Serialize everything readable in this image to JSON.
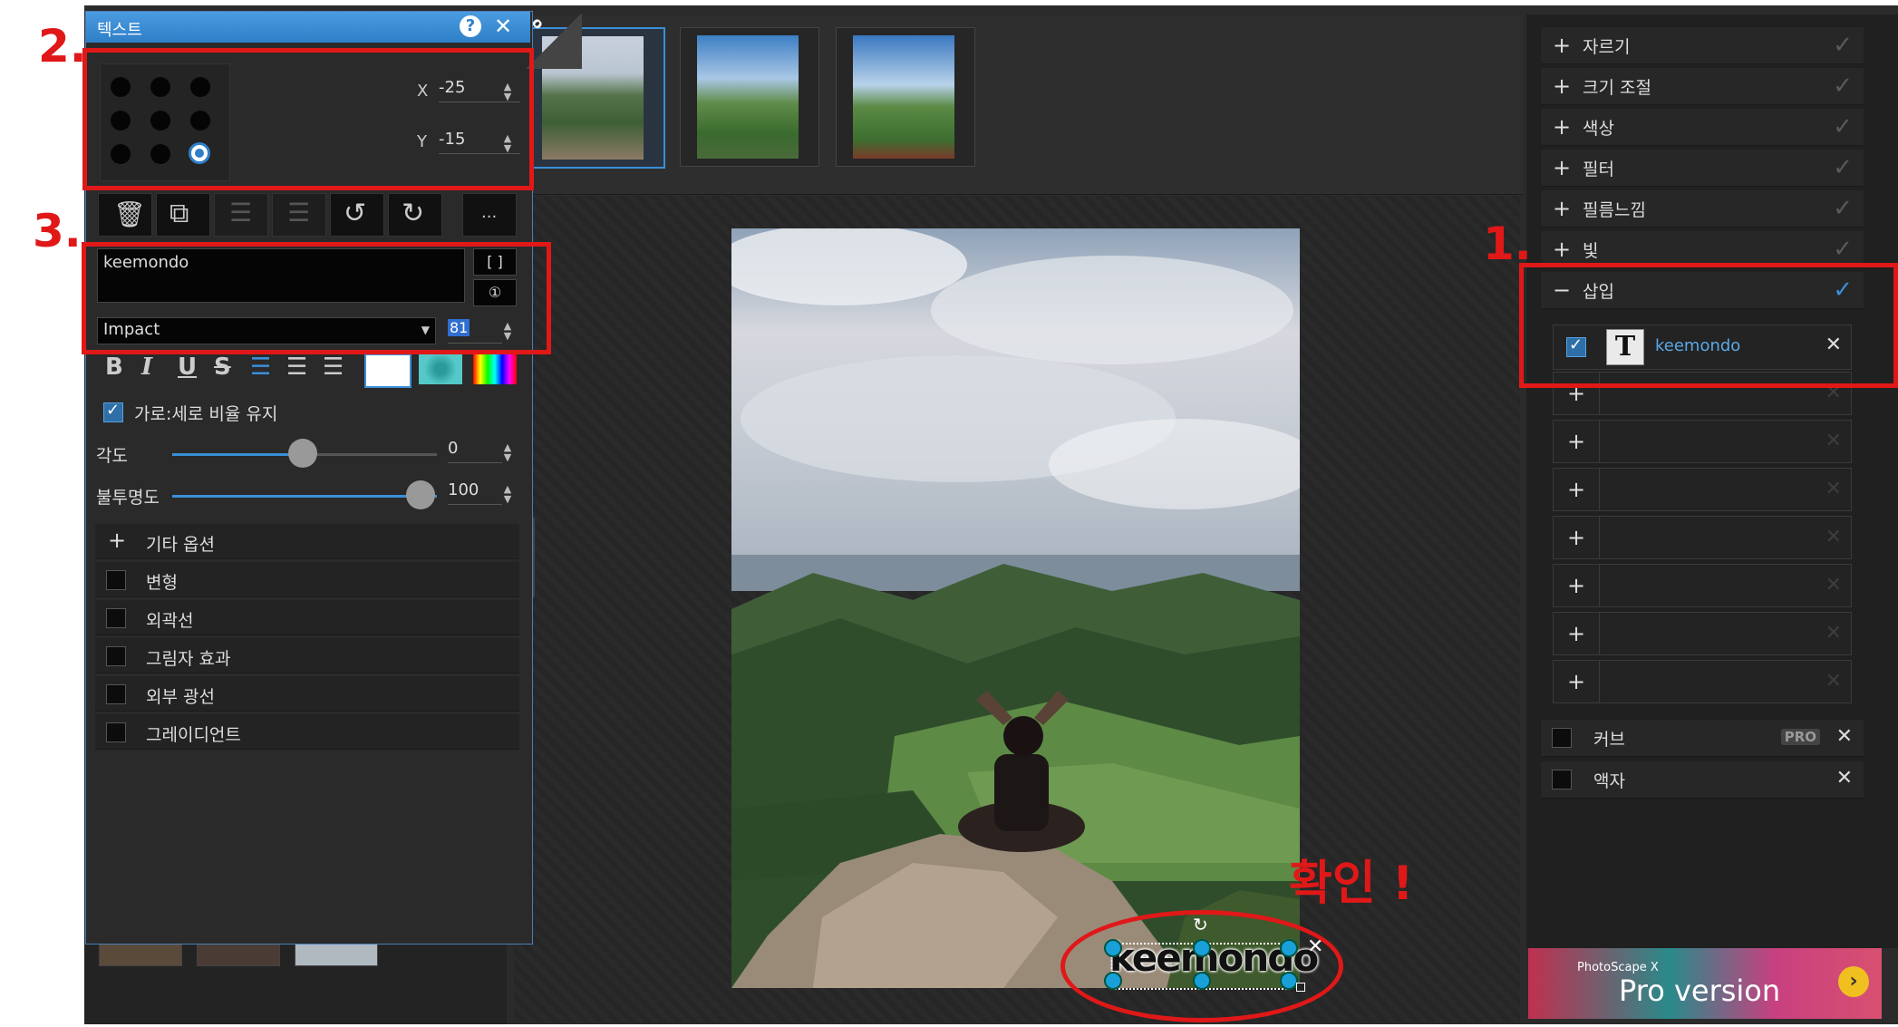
{
  "dialog": {
    "title": "텍스트",
    "help_label": "?",
    "close_label": "✕",
    "x_label": "X",
    "x_value": "-25",
    "y_label": "Y",
    "y_value": "-15",
    "more_label": "...",
    "text_value": "keemondo",
    "bracket_label": "[ ]",
    "info_label": "①",
    "font_name": "Impact",
    "font_size": "81",
    "keep_ratio_label": "가로:세로 비율 유지",
    "angle_label": "각도",
    "angle_value": "0",
    "angle_level": 0.0,
    "opacity_label": "불투명도",
    "opacity_value": "100",
    "other_options_label": "기타 옵션",
    "options": [
      "변형",
      "외곽선",
      "그림자 효과",
      "외부 광선",
      "그레이디언트"
    ],
    "format_buttons": [
      "B",
      "I",
      "U",
      "S"
    ]
  },
  "tabs_ribbon": "o",
  "right_panel": {
    "sections": [
      "자르기",
      "크기 조절",
      "색상",
      "필터",
      "필름느낌",
      "빛"
    ],
    "insert_label": "삽입",
    "insert_item_label": "keemondo",
    "curve_label": "커브",
    "curve_badge": "PRO",
    "frame_label": "액자",
    "ad_brand": "PhotoScape X",
    "ad_text": "Pro version"
  },
  "canvas": {
    "overlay_text": "keemondo"
  },
  "annotations": {
    "label_1": "1.",
    "label_2": "2.",
    "label_3": "3.",
    "confirm": "확인 !"
  },
  "colors": {
    "accent": "#3a8fd8",
    "annotation_red": "#e01818"
  }
}
